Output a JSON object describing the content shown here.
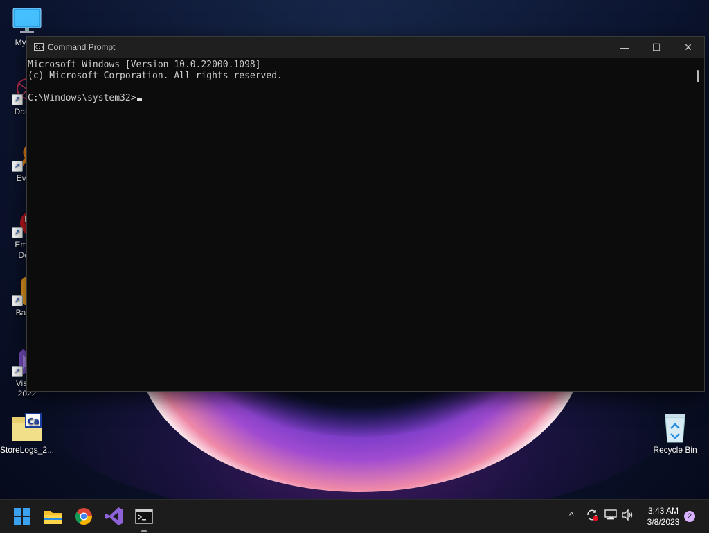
{
  "desktop": {
    "icons": [
      {
        "label": "My Co"
      },
      {
        "label": "DataW"
      },
      {
        "label": "Every"
      },
      {
        "label_line1": "Embar",
        "label_line2": "Dev-"
      },
      {
        "label": "Bad P"
      },
      {
        "label_line1": "Visual",
        "label_line2": "2022"
      },
      {
        "label": "StoreLogs_2..."
      },
      {
        "label": "Recycle Bin"
      }
    ]
  },
  "window": {
    "title": "Command Prompt",
    "controls": {
      "minimize": "—",
      "maximize": "☐",
      "close": "✕"
    },
    "console": {
      "line1": "Microsoft Windows [Version 10.0.22000.1098]",
      "line2": "(c) Microsoft Corporation. All rights reserved.",
      "prompt": "C:\\Windows\\system32>"
    }
  },
  "taskbar": {
    "apps": [
      "start-icon",
      "file-explorer-icon",
      "chrome-icon",
      "visual-studio-icon",
      "command-prompt-icon"
    ],
    "tray": {
      "chevron": "^",
      "time": "3:43 AM",
      "date": "3/8/2023",
      "notification_count": "2"
    }
  },
  "colors": {
    "console_bg": "#0c0c0c",
    "console_text": "#cccccc",
    "titlebar": "#1f1f1f",
    "taskbar": "#1c1c1c"
  }
}
